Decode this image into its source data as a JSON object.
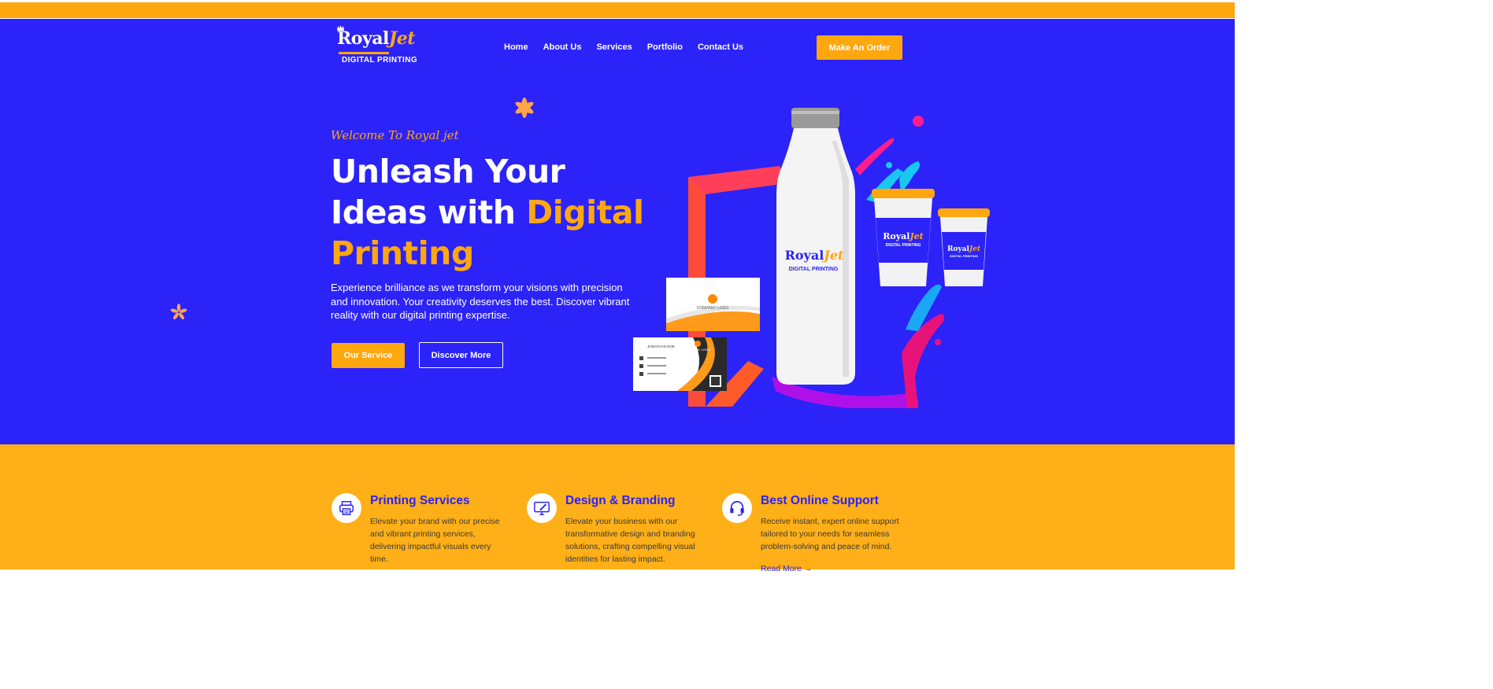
{
  "brand": {
    "logo_main": "Royal",
    "logo_jet": "Jet",
    "logo_sub": "DIGITAL PRINTING"
  },
  "nav": {
    "items": [
      "Home",
      "About Us",
      "Services",
      "Portfolio",
      "Contact Us"
    ],
    "cta_label": "Make An Order"
  },
  "hero": {
    "welcome": "Welcome To Royal jet",
    "headline_part1": "Unleash Your Ideas with ",
    "headline_accent": "Digital Printing",
    "description": "Experience brilliance as we transform your visions with precision and innovation. Your creativity deserves the best. Discover vibrant reality with our digital printing expertise.",
    "primary_button": "Our Service",
    "secondary_button": "Discover More"
  },
  "product_art": {
    "bottle_brand": "Royal",
    "bottle_brand_accent": "Jet",
    "bottle_sub": "DIGITAL PRINTING",
    "card_front_text": "COMPANY LOGO",
    "card_back_name": "JONATHAN DOE",
    "card_back_logo": "COMPANY LOGO"
  },
  "features": [
    {
      "icon": "printer-icon",
      "title": "Printing Services",
      "text": "Elevate your brand with our precise and vibrant printing services, delivering impactful visuals every time."
    },
    {
      "icon": "monitor-design-icon",
      "title": "Design & Branding",
      "text": "Elevate your business with our transformative design and branding solutions, crafting compelling visual identities for lasting impact."
    },
    {
      "icon": "headset-icon",
      "title": "Best Online Support",
      "text": "Receive instant, expert online support tailored to your needs for seamless problem-solving and peace of mind.",
      "link": "Read More →"
    }
  ],
  "colors": {
    "primary_blue": "#2C23F8",
    "accent_orange": "#FFA70F",
    "features_bg": "#FFAF17"
  }
}
